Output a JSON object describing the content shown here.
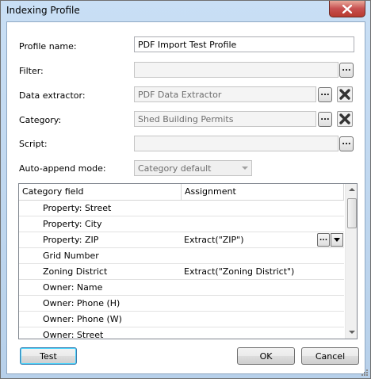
{
  "window": {
    "title": "Indexing Profile"
  },
  "form": {
    "profile_name_label": "Profile name:",
    "profile_name_value": "PDF Import Test Profile",
    "filter_label": "Filter:",
    "filter_value": "",
    "data_extractor_label": "Data extractor:",
    "data_extractor_value": "PDF Data Extractor",
    "category_label": "Category:",
    "category_value": "Shed Building Permits",
    "script_label": "Script:",
    "script_value": "",
    "auto_append_label": "Auto-append mode:",
    "auto_append_value": "Category default",
    "browse_label": "...",
    "row_browse_label": "..."
  },
  "grid": {
    "columns": [
      "Category field",
      "Assignment"
    ],
    "rows": [
      {
        "field": "Property: Street",
        "assignment": ""
      },
      {
        "field": "Property: City",
        "assignment": ""
      },
      {
        "field": "Property: ZIP",
        "assignment": "Extract(\"ZIP\")"
      },
      {
        "field": "Grid Number",
        "assignment": ""
      },
      {
        "field": "Zoning District",
        "assignment": "Extract(\"Zoning District\")"
      },
      {
        "field": "Owner: Name",
        "assignment": ""
      },
      {
        "field": "Owner: Phone (H)",
        "assignment": ""
      },
      {
        "field": "Owner: Phone (W)",
        "assignment": ""
      },
      {
        "field": "Owner: Street",
        "assignment": ""
      }
    ]
  },
  "buttons": {
    "test": "Test",
    "ok": "OK",
    "cancel": "Cancel"
  },
  "colors": {
    "title_bar": "#c9dff5",
    "close_button": "#c75050",
    "accent": "#3c7fb1"
  }
}
